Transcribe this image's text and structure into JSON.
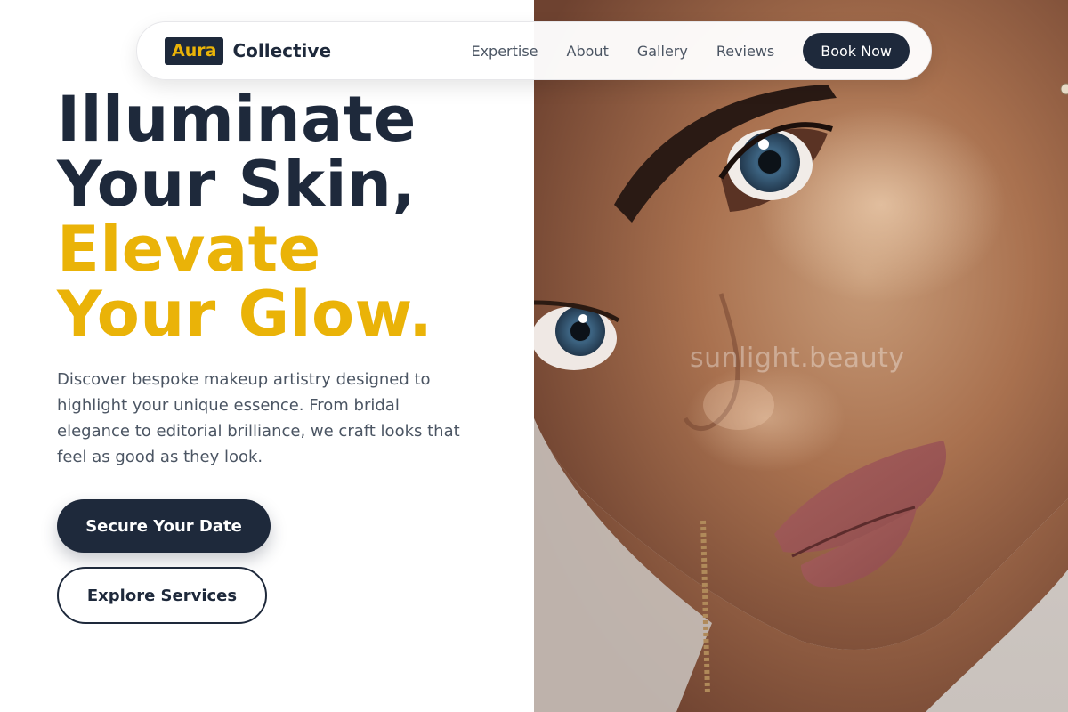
{
  "brand": {
    "badge": "Aura",
    "name": "Collective"
  },
  "nav": {
    "links": [
      "Expertise",
      "About",
      "Gallery",
      "Reviews"
    ],
    "cta": "Book Now"
  },
  "hero": {
    "headline_dark_1": "Illuminate",
    "headline_dark_2": "Your Skin,",
    "headline_gold_1": "Elevate",
    "headline_gold_2": "Your Glow.",
    "lead": "Discover bespoke makeup artistry designed to highlight your unique essence. From bridal elegance to editorial brilliance, we craft looks that feel as good as they look.",
    "primary_button": "Secure Your Date",
    "secondary_button": "Explore Services",
    "image_watermark": "sunlight.beauty"
  },
  "colors": {
    "navy": "#1e293b",
    "gold": "#eab308",
    "body_text": "#4b5563"
  }
}
